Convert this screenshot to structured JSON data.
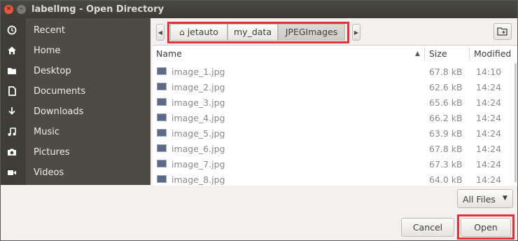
{
  "window": {
    "title": "labelImg - Open Directory"
  },
  "sidebar": {
    "items": [
      {
        "label": "Recent",
        "icon": "clock-icon"
      },
      {
        "label": "Home",
        "icon": "home-icon"
      },
      {
        "label": "Desktop",
        "icon": "folder-icon"
      },
      {
        "label": "Documents",
        "icon": "document-icon"
      },
      {
        "label": "Downloads",
        "icon": "download-icon"
      },
      {
        "label": "Music",
        "icon": "music-icon"
      },
      {
        "label": "Pictures",
        "icon": "camera-icon"
      },
      {
        "label": "Videos",
        "icon": "video-icon"
      }
    ]
  },
  "pathbar": {
    "crumbs": [
      "jetauto",
      "my_data",
      "JPEGImages"
    ],
    "active_crumb": "JPEGImages"
  },
  "filelist": {
    "columns": {
      "name": "Name",
      "size": "Size",
      "modified": "Modified"
    },
    "rows": [
      {
        "name": "image_1.jpg",
        "size": "67.8 kB",
        "modified": "14:10"
      },
      {
        "name": "image_2.jpg",
        "size": "62.6 kB",
        "modified": "14:24"
      },
      {
        "name": "image_3.jpg",
        "size": "65.6 kB",
        "modified": "14:24"
      },
      {
        "name": "image_4.jpg",
        "size": "66.2 kB",
        "modified": "14:24"
      },
      {
        "name": "image_5.jpg",
        "size": "63.9 kB",
        "modified": "14:24"
      },
      {
        "name": "image_6.jpg",
        "size": "67.8 kB",
        "modified": "14:24"
      },
      {
        "name": "image_7.jpg",
        "size": "67.3 kB",
        "modified": "14:24"
      },
      {
        "name": "image_8.jpg",
        "size": "64.0 kB",
        "modified": "14:24"
      }
    ]
  },
  "filter": {
    "label": "All Files"
  },
  "buttons": {
    "cancel": "Cancel",
    "open": "Open"
  },
  "colors": {
    "highlight": "#e53238",
    "sidebar": "#4d4b44",
    "titlebar": "#3c3b37"
  }
}
